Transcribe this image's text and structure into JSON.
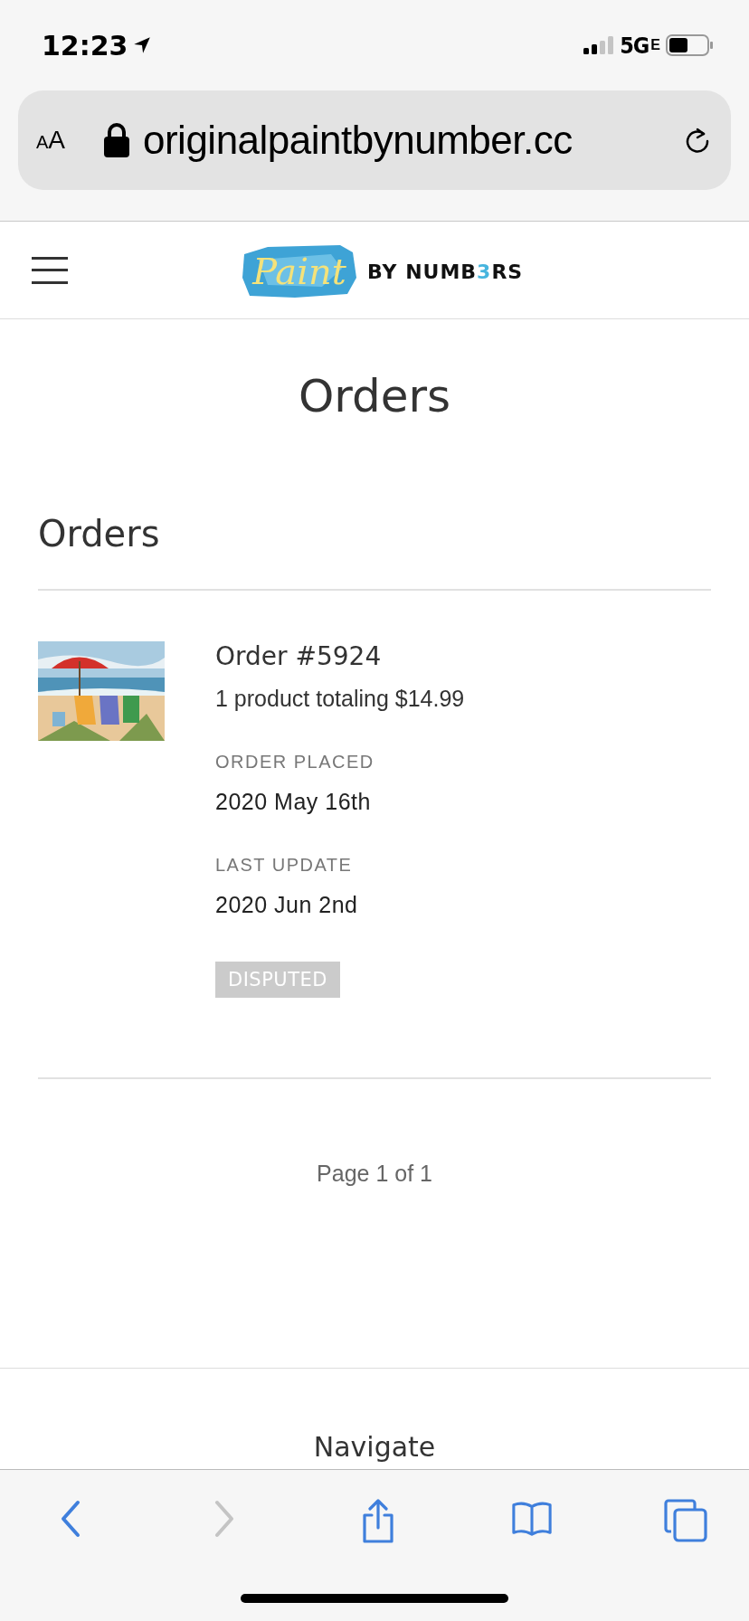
{
  "status_bar": {
    "time": "12:23",
    "network": "5G",
    "network_suffix": "E"
  },
  "browser": {
    "text_size_button": "AA",
    "url": "originalpaintbynumber.cc"
  },
  "header": {
    "logo": {
      "script": "Paint",
      "parts": [
        {
          "text": "BY NUMB",
          "accent": false
        },
        {
          "text": "3",
          "accent": true
        },
        {
          "text": "RS",
          "accent": false
        }
      ]
    }
  },
  "page_title": "Orders",
  "section_title": "Orders",
  "orders": [
    {
      "title": "Order #5924",
      "summary": "1 product totaling $14.99",
      "placed_label": "ORDER PLACED",
      "placed": "2020 May 16th",
      "update_label": "LAST UPDATE",
      "updated": "2020 Jun 2nd",
      "status": "DISPUTED"
    }
  ],
  "pagination": "Page 1 of 1",
  "footer": {
    "heading": "Navigate"
  },
  "toolbar": [
    {
      "kind": "back",
      "disabled": false
    },
    {
      "kind": "forward",
      "disabled": true
    },
    {
      "kind": "share",
      "disabled": false
    },
    {
      "kind": "bookmarks",
      "disabled": false
    },
    {
      "kind": "tabs",
      "disabled": false
    }
  ]
}
